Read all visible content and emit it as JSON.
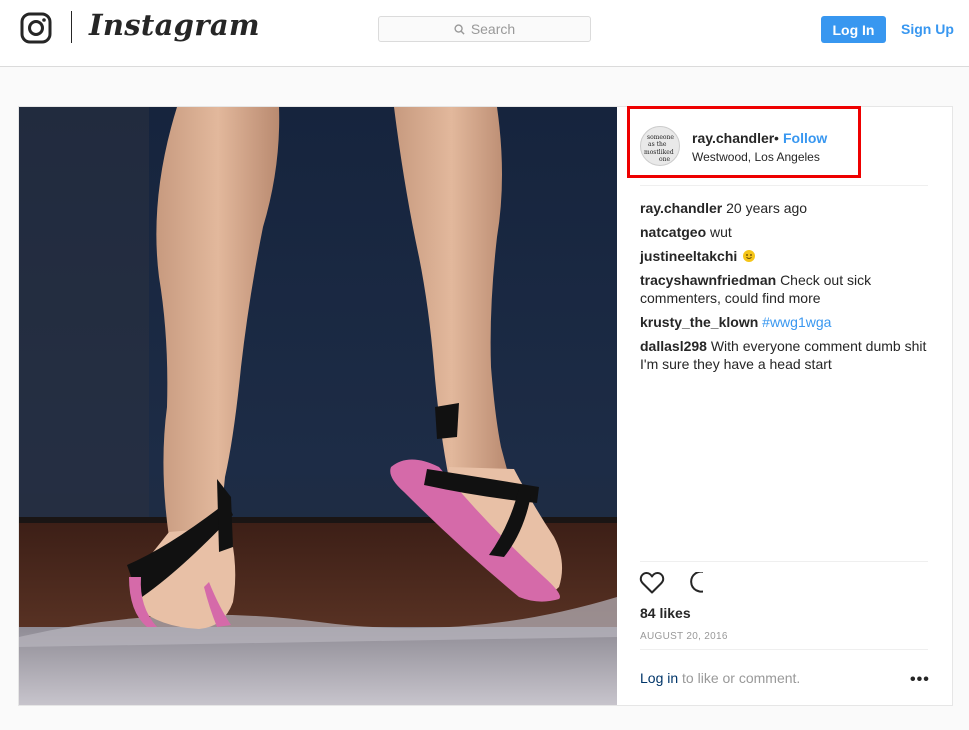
{
  "header": {
    "wordmark": "Instagram",
    "search_placeholder": "Search",
    "login_label": "Log In",
    "signup_label": "Sign Up",
    "accent_color": "#3897f0"
  },
  "post": {
    "author": {
      "username": "ray.chandler",
      "separator": "•",
      "follow_label": "Follow",
      "location": "Westwood, Los Angeles",
      "avatar_text": [
        "someone",
        "as the",
        "mostliked",
        "one"
      ]
    },
    "comments": [
      {
        "user": "ray.chandler",
        "text": "20 years ago"
      },
      {
        "user": "natcatgeo",
        "text": "wut"
      },
      {
        "user": "justineeltakchi",
        "text": "",
        "emoji": "smiling-face-emoji"
      },
      {
        "user": "tracyshawnfriedman",
        "text": "Check out sick commenters, could find more"
      },
      {
        "user": "krusty_the_klown",
        "text": "",
        "hashtag": "#wwg1wga"
      },
      {
        "user": "dallasl298",
        "text": "With everyone comment dumb shit I'm sure they have a head start"
      }
    ],
    "likes": "84 likes",
    "date": "AUGUST 20, 2016",
    "login_link": "Log in",
    "login_suffix": " to like or comment.",
    "more_label": "•••",
    "icons": [
      "heart-icon",
      "comment-bubble-icon",
      "search-icon",
      "instagram-camera-icon"
    ],
    "highlight_color": "#e00000"
  }
}
